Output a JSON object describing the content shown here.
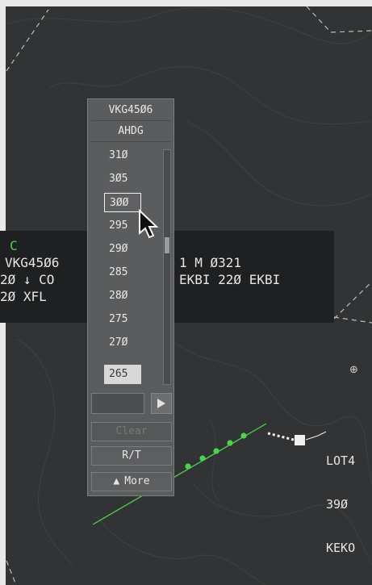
{
  "flight_label": {
    "tag": "C",
    "row1_left": "VKG45Ø6",
    "row1_right": "1 M Ø321",
    "row2_left": "2Ø ↓ CO",
    "row2_right": "EKBI 22Ø EKBI",
    "row3_left": "2Ø XFL"
  },
  "right_label": {
    "line1": "LOT4",
    "line2": "39Ø",
    "line3": "KEKO"
  },
  "menu": {
    "callsign": "VKG45Ø6",
    "mode": "AHDG",
    "levels": [
      "31Ø",
      "3Ø5",
      "3ØØ",
      "295",
      "29Ø",
      "285",
      "28Ø",
      "275",
      "27Ø",
      "265"
    ],
    "hover_level": "3ØØ",
    "selected_level": "265",
    "input_value": "",
    "clear_label": "Clear",
    "rt_label": "R/T",
    "more_label": "More"
  },
  "colors": {
    "background": "#323334",
    "label_background": "#1f2021",
    "green": "#4fcf4f"
  }
}
